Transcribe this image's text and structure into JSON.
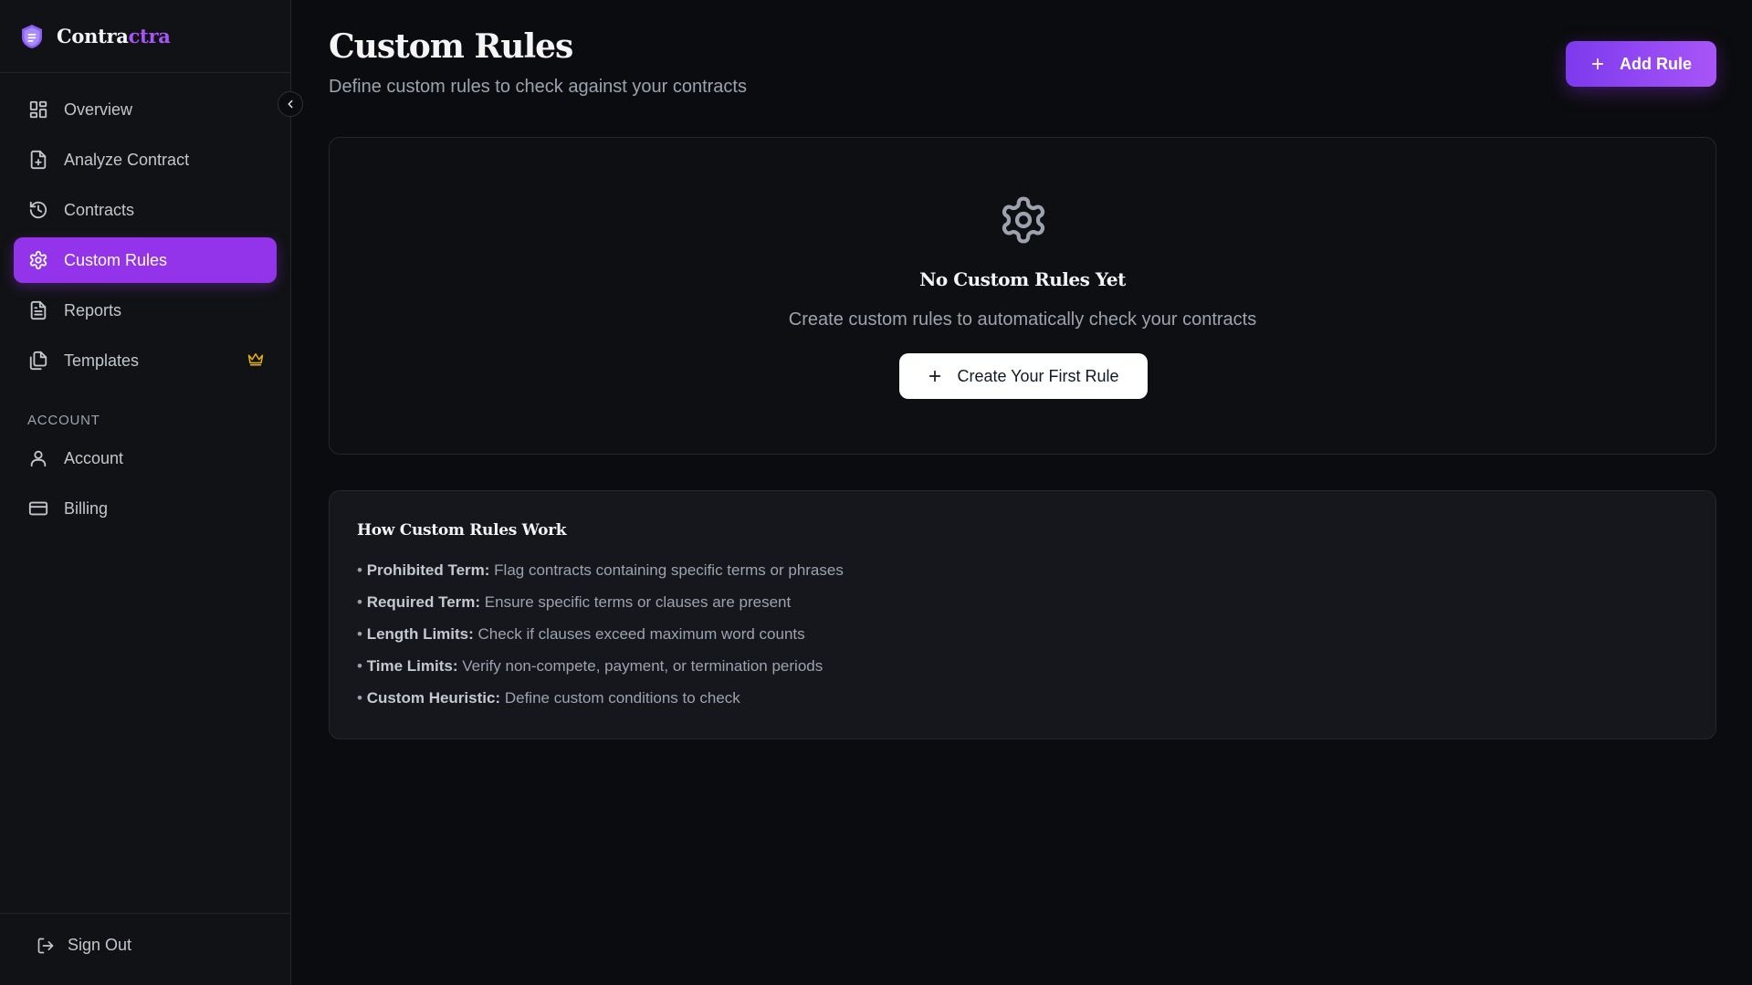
{
  "brand": {
    "name_main": "Contra",
    "name_accent": "ctra",
    "logo_icon": "shield-doc-icon"
  },
  "colors": {
    "accent": "#9333ea",
    "accent_light": "#a855f7",
    "crown": "#eab308",
    "background": "#0b0c0f"
  },
  "sidebar": {
    "items": [
      {
        "label": "Overview",
        "icon": "grid-icon"
      },
      {
        "label": "Analyze Contract",
        "icon": "file-plus-icon"
      },
      {
        "label": "Contracts",
        "icon": "history-icon"
      },
      {
        "label": "Custom Rules",
        "icon": "gear-icon",
        "active": true
      },
      {
        "label": "Reports",
        "icon": "file-text-icon"
      },
      {
        "label": "Templates",
        "icon": "files-icon",
        "badge_icon": "crown-icon"
      }
    ],
    "account_section_label": "ACCOUNT",
    "account_items": [
      {
        "label": "Account",
        "icon": "user-icon"
      },
      {
        "label": "Billing",
        "icon": "credit-card-icon"
      }
    ],
    "sign_out_label": "Sign Out"
  },
  "header": {
    "title": "Custom Rules",
    "subtitle": "Define custom rules to check against your contracts",
    "add_button_label": "Add Rule"
  },
  "empty_state": {
    "title": "No Custom Rules Yet",
    "description": "Create custom rules to automatically check your contracts",
    "button_label": "Create Your First Rule"
  },
  "info": {
    "title": "How Custom Rules Work",
    "items": [
      {
        "term": "Prohibited Term:",
        "text": "Flag contracts containing specific terms or phrases"
      },
      {
        "term": "Required Term:",
        "text": "Ensure specific terms or clauses are present"
      },
      {
        "term": "Length Limits:",
        "text": "Check if clauses exceed maximum word counts"
      },
      {
        "term": "Time Limits:",
        "text": "Verify non-compete, payment, or termination periods"
      },
      {
        "term": "Custom Heuristic:",
        "text": "Define custom conditions to check"
      }
    ]
  }
}
